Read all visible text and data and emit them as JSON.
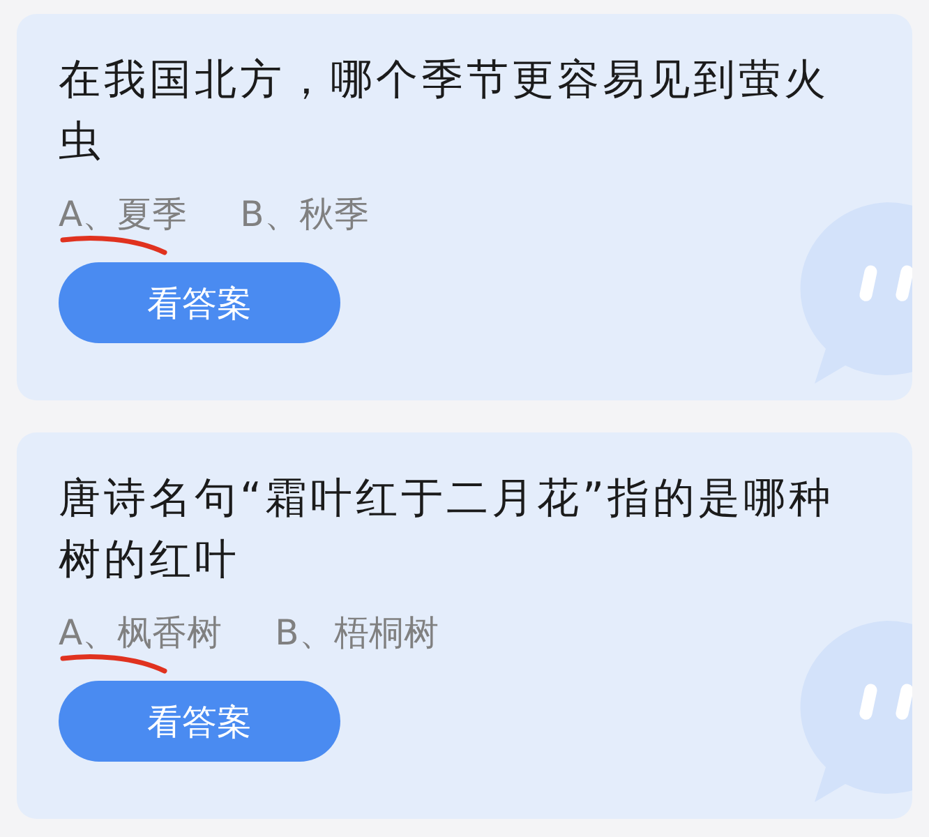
{
  "cards": [
    {
      "question": "在我国北方，哪个季节更容易见到萤火虫",
      "options": [
        {
          "text": "A、夏季",
          "underlined": true
        },
        {
          "text": "B、秋季",
          "underlined": false
        }
      ],
      "button": "看答案"
    },
    {
      "question": "唐诗名句“霜叶红于二月花”指的是哪种树的红叶",
      "options": [
        {
          "text": "A、枫香树",
          "underlined": true
        },
        {
          "text": "B、梧桐树",
          "underlined": false
        }
      ],
      "button": "看答案"
    }
  ]
}
